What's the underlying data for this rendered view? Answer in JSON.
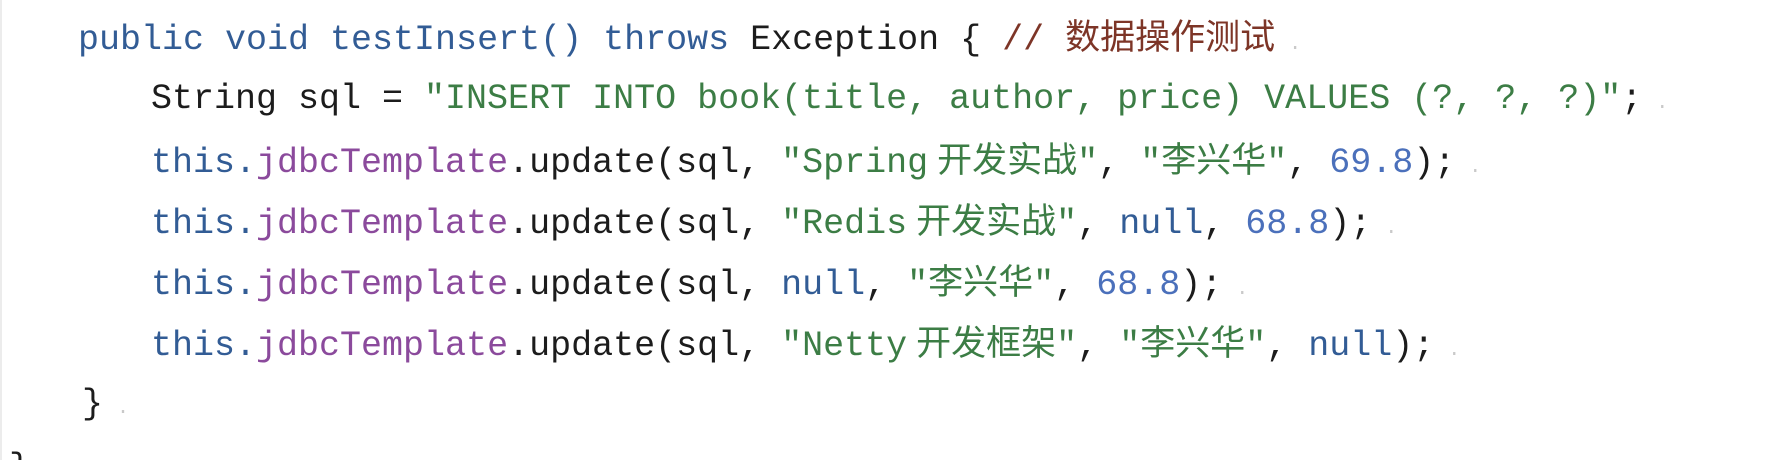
{
  "colors": {
    "background": "#ffffff",
    "plain": "#1c1c1c",
    "keyword": "#325c95",
    "comment": "#7d3527",
    "string": "#3c7d45",
    "field": "#8b4a9c",
    "number": "#4b70bb",
    "marker": "#c9c9c9",
    "edge": "#ececec"
  },
  "code": {
    "end_marker": "·",
    "lines": [
      [
        "public void testInsert() throws",
        " Exception { ",
        "// 数据操作测试"
      ],
      [
        "String sql = ",
        "\"INSERT INTO book(title, author, price) VALUES (?, ?, ?)\"",
        ";"
      ],
      [
        "this.",
        "jdbcTemplate",
        ".update(sql, ",
        "\"Spring",
        "开发实战\"",
        ", ",
        "\"李兴华\"",
        ", ",
        "69.8",
        ");"
      ],
      [
        "this.",
        "jdbcTemplate",
        ".update(sql, ",
        "\"Redis",
        "开发实战\"",
        ", ",
        "null",
        ", ",
        "68.8",
        ");"
      ],
      [
        "this.",
        "jdbcTemplate",
        ".update(sql, ",
        "null",
        ", ",
        "\"李兴华\"",
        ", ",
        "68.8",
        ");"
      ],
      [
        "this.",
        "jdbcTemplate",
        ".update(sql, ",
        "\"Netty",
        "开发框架\"",
        ", ",
        "\"李兴华\"",
        ", ",
        "null",
        ");"
      ],
      [
        "}"
      ],
      [
        "}"
      ]
    ]
  }
}
